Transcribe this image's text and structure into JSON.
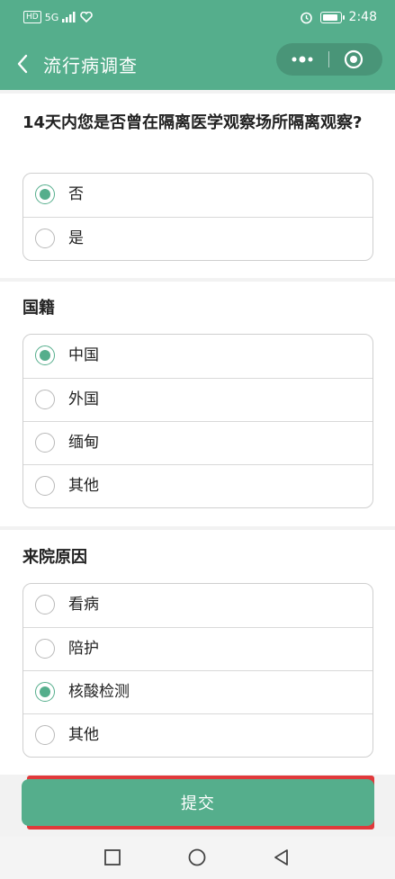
{
  "status_bar": {
    "left_badges": [
      "HD",
      "5G"
    ],
    "time": "2:48"
  },
  "nav": {
    "title": "流行病调查",
    "back_icon": "chevron-left-icon",
    "more_icon": "more-dots-icon",
    "close_icon": "target-icon"
  },
  "questions": [
    {
      "title": "14天内您是否曾在隔离医学观察场所隔离观察?",
      "options": [
        {
          "label": "否",
          "checked": true
        },
        {
          "label": "是",
          "checked": false
        }
      ]
    },
    {
      "title": "国籍",
      "options": [
        {
          "label": "中国",
          "checked": true
        },
        {
          "label": "外国",
          "checked": false
        },
        {
          "label": "缅甸",
          "checked": false
        },
        {
          "label": "其他",
          "checked": false
        }
      ]
    },
    {
      "title": "来院原因",
      "options": [
        {
          "label": "看病",
          "checked": false
        },
        {
          "label": "陪护",
          "checked": false
        },
        {
          "label": "核酸检测",
          "checked": true
        },
        {
          "label": "其他",
          "checked": false
        }
      ]
    }
  ],
  "submit": {
    "label": "提交"
  },
  "colors": {
    "brand": "#55ae8c",
    "highlight": "#e0393b"
  }
}
